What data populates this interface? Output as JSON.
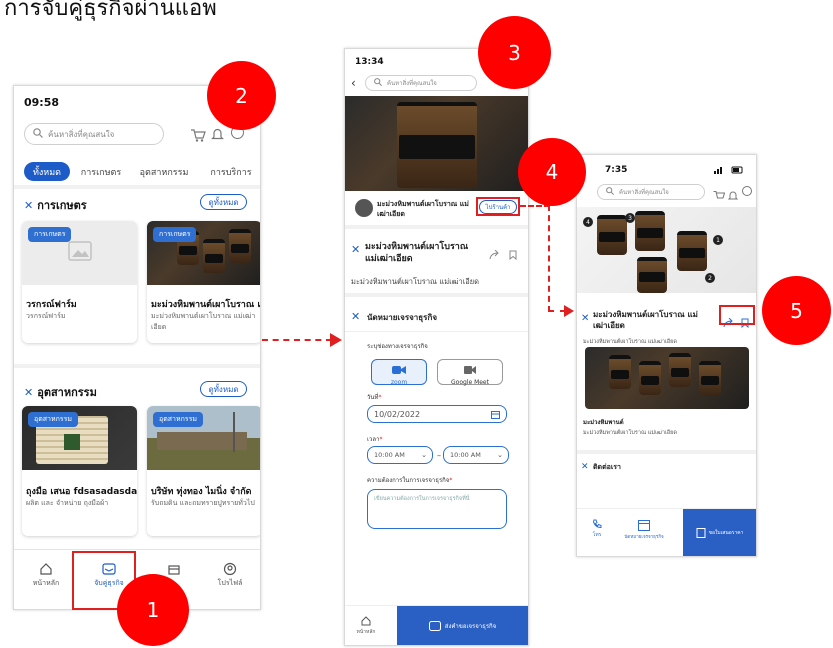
{
  "heading": "การจับคู่ธุรกิจผ่านแอพ",
  "markers": [
    "1",
    "2",
    "3",
    "4",
    "5"
  ],
  "screen1": {
    "time": "09:58",
    "search_placeholder": "ค้นหาสิ่งที่คุณสนใจ",
    "tabs": [
      "ทั้งหมด",
      "การเกษตร",
      "อุตสาหกรรม",
      "การบริการ"
    ],
    "agri": {
      "title": "การเกษตร",
      "see_all": "ดูทั้งหมด",
      "cards": [
        {
          "badge": "การเกษตร",
          "title": "วรกรณ์ฟาร์ม",
          "sub": "วรกรณ์ฟาร์ม"
        },
        {
          "badge": "การเกษตร",
          "title": "มะม่วงหิมพานต์เผาโบราณ แม่",
          "sub": "มะม่วงหิมพานต์เผาโบราณ แม่เฒ่าเอียด"
        }
      ]
    },
    "industry": {
      "title": "อุตสาหกรรม",
      "see_all": "ดูทั้งหมด",
      "cards": [
        {
          "badge": "อุตสาหกรรม",
          "title": "ถุงมือ เสนอ fdsasadasda",
          "sub": "ผลิต และ จำหน่าย ถุงมือผ้า"
        },
        {
          "badge": "อุตสาหกรรม",
          "title": "บริษัท ทุ่งทอง ไมนิ่ง จำกัด",
          "sub": "รับถมดิน และถมทรายปูทรายทั่วไป"
        }
      ]
    },
    "nav": [
      "หน้าหลัก",
      "จับคู่ธุรกิจ",
      "",
      "โปรไฟล์"
    ]
  },
  "screen2": {
    "time": "13:34",
    "search_placeholder": "ค้นหาสิ่งที่คุณสนใจ",
    "seller_name": "มะม่วงหิมพานต์เผาโบราณ แม่เฒ่าเอียด",
    "visit_shop": "ไปร้านค้า",
    "product_title": "มะม่วงหิมพานต์เผาโบราณ แม่เฒ่าเอียด",
    "product_sub": "มะม่วงหิมพานต์เผาโบราณ แม่เฒ่าเอียด",
    "appointment_title": "นัดหมายเจรจาธุรกิจ",
    "channel_label": "ระบุช่องทางเจรจาธุรกิจ",
    "zoom": "zoom",
    "google_meet": "Google Meet",
    "date_label": "วันที่",
    "date_value": "10/02/2022",
    "time_label": "เวลา",
    "time_from": "10:00 AM",
    "time_to": "10:00 AM",
    "needs_label": "ความต้องการในการเจรจาธุรกิจ",
    "needs_placeholder": "เขียนความต้องการในการเจรจาธุรกิจที่นี่",
    "nav_home": "หน้าหลัก",
    "submit": "ส่งคำขอเจรจาธุรกิจ"
  },
  "screen3": {
    "time": "7:35",
    "search_placeholder": "ค้นหาสิ่งที่คุณสนใจ",
    "title": "มะม่วงหิมพานต์เผาโบราณ แม่เฒ่าเอียด",
    "sub": "มะม่วงหิมพานต์เผาโบราณ แม่เฒ่าเอียด",
    "item_title": "มะม่วงหิมพานต์",
    "item_sub": "มะม่วงหิมพานต์เผาโบราณ แม่เฒ่าเอียด",
    "contact": "ติดต่อเรา",
    "nav_tel": "โทร",
    "nav_appoint": "นัดหมายเจรจาธุรกิจ",
    "nav_quote": "ขอใบเสนอราคา",
    "photo_numbers": [
      "4",
      "3",
      "1",
      "2"
    ]
  }
}
